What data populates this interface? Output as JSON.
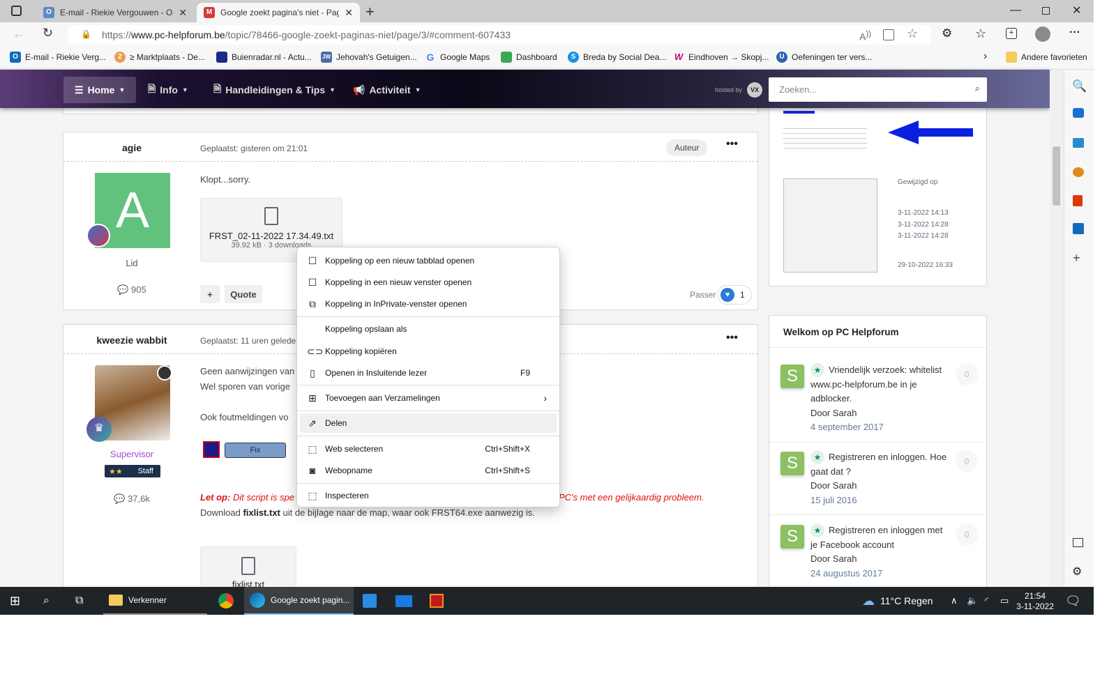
{
  "browser": {
    "tabs": [
      {
        "title": "E-mail - Riekie Vergouwen - Outl",
        "active": false
      },
      {
        "title": "Google zoekt pagina's niet - Pag",
        "active": true
      }
    ],
    "url_prefix": "https://",
    "url_domain": "www.pc-helpforum.be",
    "url_path": "/topic/78466-google-zoekt-paginas-niet/page/3/#comment-607433",
    "favorites": [
      {
        "label": "E-mail - Riekie Verg...",
        "icon": "outlook-icon",
        "color": "#0f6cbd"
      },
      {
        "label": "≥ Marktplaats - De...",
        "icon": "marktplaats-icon",
        "color": "#e8a04f"
      },
      {
        "label": "Buienradar.nl - Actu...",
        "icon": "buienradar-icon",
        "color": "#1a2a8a"
      },
      {
        "label": "Jehovah's Getuigen...",
        "icon": "jw-icon",
        "color": "#4a6da7"
      },
      {
        "label": "Google Maps",
        "icon": "google-icon",
        "color": "#4285f4"
      },
      {
        "label": "Dashboard",
        "icon": "dashboard-icon",
        "color": "#3aa757"
      },
      {
        "label": "Breda by Social Dea...",
        "icon": "socialdeal-icon",
        "color": "#1a8fe3"
      },
      {
        "label": "Eindhoven → Skopj...",
        "icon": "wizzair-icon",
        "color": "#c6007e"
      },
      {
        "label": "Oefeningen ter vers...",
        "icon": "gear-site-icon",
        "color": "#2a64b0"
      }
    ],
    "other_favorites": "Andere favorieten"
  },
  "site": {
    "nav": [
      "Home",
      "Info",
      "Handleidingen & Tips",
      "Activiteit"
    ],
    "hosted_by": "hosted by",
    "search_placeholder": "Zoeken..."
  },
  "posts": [
    {
      "author": "agie",
      "posted": "Geplaatst: gisteren om 21:01",
      "badge": "Auteur",
      "avatar_letter": "A",
      "role": "Lid",
      "post_count": "905",
      "body": "Klopt...sorry.",
      "attachment": {
        "name": "FRST_02-11-2022 17.34.49.txt",
        "meta": "39.92 kB · 3 downloads"
      },
      "actions": {
        "plus": "+",
        "quote": "Quote"
      },
      "reaction_user": "Passer",
      "reaction_count": "1"
    },
    {
      "author": "kweezie wabbit",
      "posted": "Geplaatst: 11 uren geleden",
      "role": "Supervisor",
      "staff_label": "Staff",
      "post_count": "37,6k",
      "lines": [
        "Geen aanwijzingen van",
        "Wel sporen van vorige",
        "Ook foutmeldingen vo"
      ],
      "fix_button": "Fix",
      "warning_label": "Let op:",
      "warning_text_start": "Dit script is spe",
      "warning_text_end": "PC's met een gelijkaardig probleem.",
      "download_pre": "Download ",
      "download_file": "fixlist.txt",
      "download_post": " uit de bijlage naar de map, waar ook FRST64.exe aanwezig is.",
      "attachment": {
        "name": "fixlist.txt"
      }
    }
  ],
  "sidebar_image": {
    "column_header": "Gewijzigd op",
    "dates": [
      "3-11-2022 14:13",
      "3-11-2022 14:28",
      "3-11-2022 14:28",
      "29-10-2022 16:33"
    ]
  },
  "welcome": {
    "title": "Welkom op PC Helpforum",
    "items": [
      {
        "title": "Vriendelijk verzoek: whitelist www.pc-helpforum.be in je adblocker.",
        "author": "Door Sarah",
        "date": "4 september 2017",
        "count": "0"
      },
      {
        "title": "Registreren en inloggen. Hoe gaat dat ?",
        "author": "Door Sarah",
        "date": "15 juli 2016",
        "count": "0"
      },
      {
        "title": "Registreren en inloggen met je Facebook account",
        "author": "Door Sarah",
        "date": "24 augustus 2017",
        "count": "0"
      }
    ]
  },
  "context_menu": {
    "items": [
      {
        "label": "Koppeling op een nieuw tabblad openen",
        "icon": "new-tab-icon"
      },
      {
        "label": "Koppeling in een nieuw venster openen",
        "icon": "new-window-icon"
      },
      {
        "label": "Koppeling in InPrivate-venster openen",
        "icon": "inprivate-icon"
      },
      {
        "label": "Koppeling opslaan als"
      },
      {
        "label": "Koppeling kopiëren",
        "icon": "link-icon"
      },
      {
        "label": "Openen in Insluitende lezer",
        "shortcut": "F9",
        "icon": "immersive-reader-icon"
      },
      {
        "label": "Toevoegen aan Verzamelingen",
        "icon": "collections-icon"
      },
      {
        "label": "Delen",
        "icon": "share-icon",
        "highlighted": true
      },
      {
        "label": "Web selecteren",
        "shortcut": "Ctrl+Shift+X",
        "icon": "web-select-icon"
      },
      {
        "label": "Webopname",
        "shortcut": "Ctrl+Shift+S",
        "icon": "web-capture-icon"
      },
      {
        "label": "Inspecteren",
        "icon": "inspect-icon"
      }
    ]
  },
  "taskbar": {
    "explorer": "Verkenner",
    "edge": "Google zoekt pagin...",
    "weather": "11°C  Regen",
    "time": "21:54",
    "date": "3-11-2022"
  }
}
